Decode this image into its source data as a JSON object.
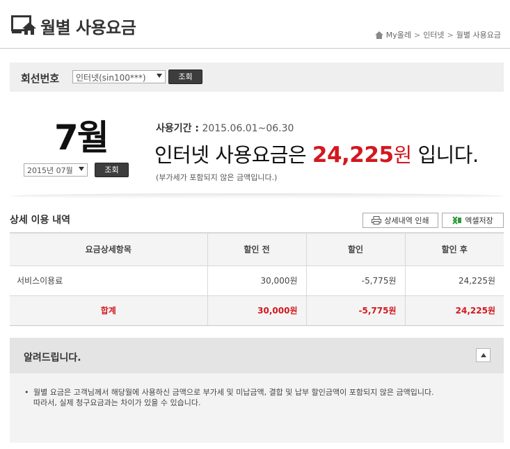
{
  "header": {
    "title": "월별 사용요금",
    "breadcrumb": [
      "My올레",
      "인터넷",
      "월별 사용요금"
    ],
    "breadcrumb_sep": ">"
  },
  "line_selector": {
    "label": "회선번호",
    "selected": "인터넷(sin100***)",
    "button": "조회"
  },
  "summary": {
    "month_big": "7월",
    "month_select": "2015년 07월",
    "button": "조회",
    "period_label": "사용기간 :",
    "period_value": "2015.06.01~06.30",
    "amount_prefix": "인터넷 사용요금은",
    "amount": "24,225",
    "amount_unit": "원",
    "amount_suffix": "입니다.",
    "vat_note": "(부가세가 포함되지 않은 금액입니다.)"
  },
  "detail": {
    "title": "상세 이용 내역",
    "print_button": "상세내역 인쇄",
    "excel_button": "엑셀저장",
    "columns": [
      "요금상세항목",
      "할인 전",
      "할인",
      "할인 후"
    ],
    "rows": [
      {
        "item": "서비스이용료",
        "before": "30,000원",
        "discount": "-5,775원",
        "after": "24,225원"
      }
    ],
    "total": {
      "item": "합계",
      "before": "30,000원",
      "discount": "-5,775원",
      "after": "24,225원"
    }
  },
  "notice": {
    "title": "알려드립니다.",
    "bullet": "•",
    "line1": "월별 요금은 고객님께서 해당월에 사용하신 금액으로 부가세 및 미납금액, 결합 및 납부 할인금액이 포함되지 않은 금액입니다.",
    "line2": "따라서, 실제 청구요금과는 차이가 있을 수 있습니다."
  },
  "colors": {
    "accent_red": "#d2181f",
    "dark_button": "#3d3d3d",
    "excel_green": "#2e9a3a"
  }
}
